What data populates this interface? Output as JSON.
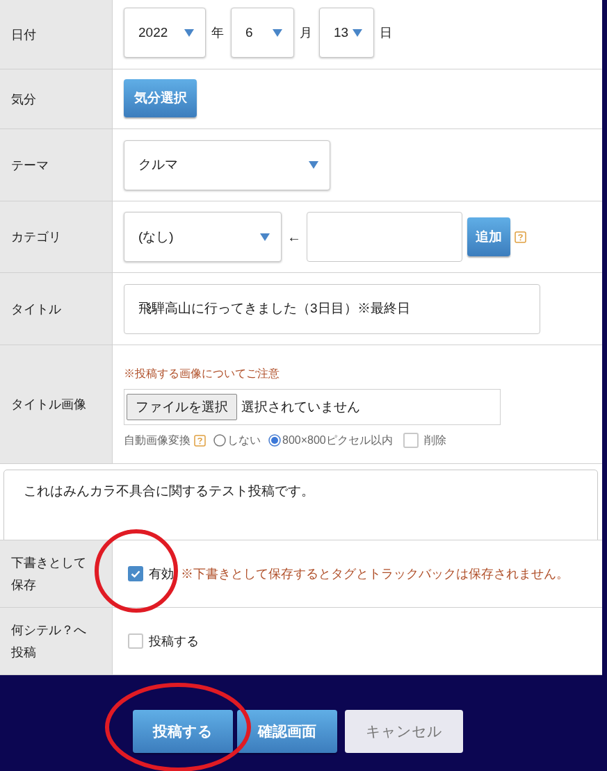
{
  "rows": [
    {
      "kind": "date",
      "label": "日付",
      "selects": [
        {
          "value": "2022",
          "suffix": "年"
        },
        {
          "value": "6",
          "suffix": "月"
        },
        {
          "value": "13",
          "suffix": "日"
        }
      ]
    },
    {
      "kind": "button",
      "label": "気分",
      "button": "気分選択"
    },
    {
      "kind": "select",
      "label": "テーマ",
      "value": "クルマ"
    },
    {
      "kind": "category",
      "label": "カテゴリ",
      "value": "(なし)",
      "arrow": "←",
      "button": "追加"
    },
    {
      "kind": "text",
      "label": "タイトル",
      "value": "飛騨高山に行ってきました（3日目）※最終日"
    },
    {
      "kind": "image",
      "label": "タイトル画像",
      "notice": "※投稿する画像についてご注意",
      "file_button": "ファイルを選択",
      "file_status": "選択されていません",
      "convert_label": "自動画像変換",
      "options": [
        {
          "label": "しない",
          "selected": false
        },
        {
          "label": "800×800ピクセル以内",
          "selected": true
        }
      ],
      "delete": {
        "label": "削除",
        "checked": false
      }
    }
  ],
  "body": "これはみんカラ不具合に関するテスト投稿です。",
  "checks": [
    {
      "label": "下書きとして保存",
      "checked": true,
      "checkbox_label": "有効",
      "note": "※下書きとして保存するとタグとトラックバックは保存されません。"
    },
    {
      "label": "何シテル？へ投稿",
      "checked": false,
      "checkbox_label": "投稿する"
    }
  ],
  "buttons": [
    {
      "label": "投稿する",
      "kind": "primary"
    },
    {
      "label": "確認画面",
      "kind": "primary"
    },
    {
      "label": "キャンセル",
      "kind": "secondary"
    }
  ]
}
